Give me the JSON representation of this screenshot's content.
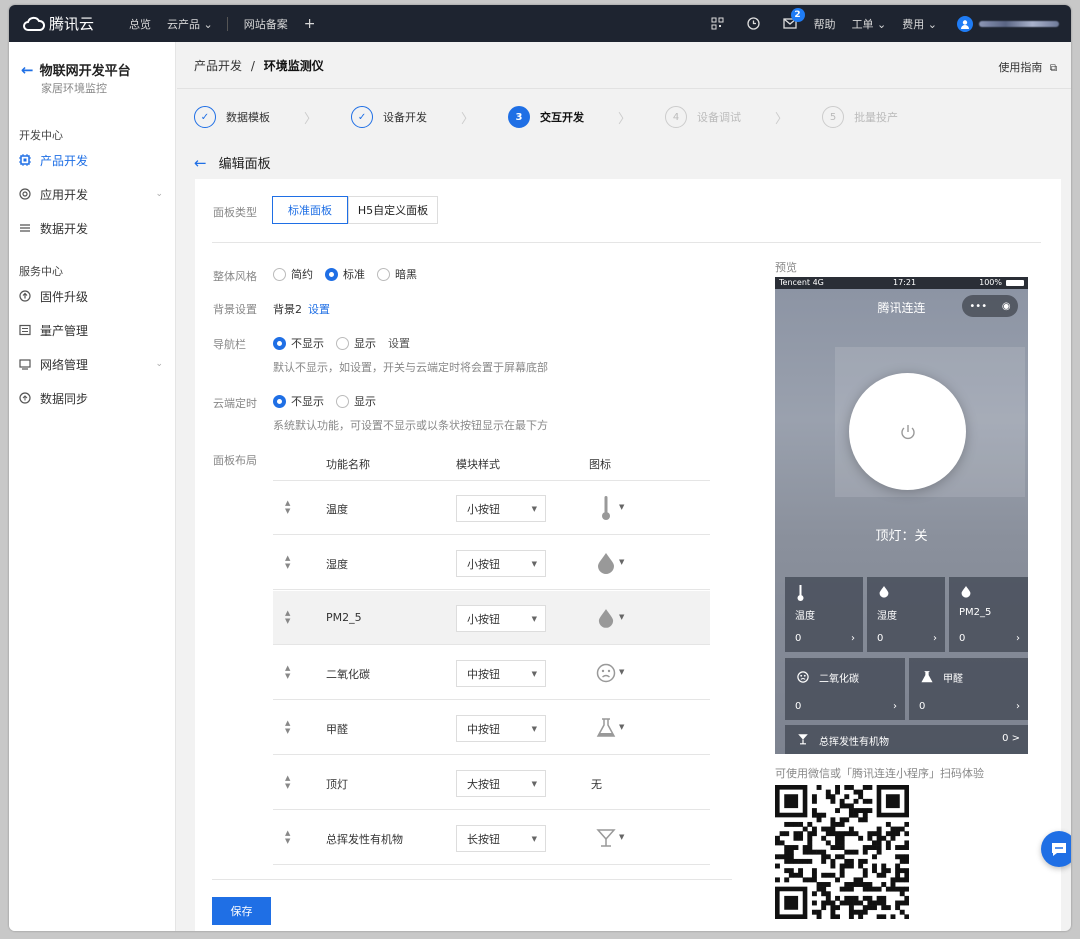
{
  "topbar": {
    "brand": "腾讯云",
    "items": [
      "总览",
      "云产品 ⌄",
      "网站备案"
    ],
    "plus": "+",
    "right_items": {
      "help": "帮助",
      "ticket": "工单 ⌄",
      "billing": "费用 ⌄"
    },
    "mail_badge": "2"
  },
  "sidebar": {
    "back_title": "物联网开发平台",
    "subtitle": "家居环境监控",
    "group1": "开发中心",
    "items1": [
      "产品开发",
      "应用开发",
      "数据开发"
    ],
    "group2": "服务中心",
    "items2": [
      "固件升级",
      "量产管理",
      "网络管理",
      "数据同步"
    ]
  },
  "breadcrumb": {
    "parent": "产品开发",
    "sep": "/",
    "current": "环境监测仪"
  },
  "guide_link": "使用指南",
  "steps": [
    {
      "num": "✓",
      "label": "数据模板",
      "state": "done"
    },
    {
      "num": "✓",
      "label": "设备开发",
      "state": "done"
    },
    {
      "num": "3",
      "label": "交互开发",
      "state": "current"
    },
    {
      "num": "4",
      "label": "设备调试",
      "state": "todo"
    },
    {
      "num": "5",
      "label": "批量投产",
      "state": "todo"
    }
  ],
  "edit_title": "编辑面板",
  "form": {
    "panel_type_label": "面板类型",
    "panel_types": [
      "标准面板",
      "H5自定义面板"
    ],
    "style_label": "整体风格",
    "styles": [
      "简约",
      "标准",
      "暗黑"
    ],
    "bg_label": "背景设置",
    "bg_value": "背景2",
    "bg_link": "设置",
    "nav_label": "导航栏",
    "nav_options": [
      "不显示",
      "显示"
    ],
    "nav_link": "设置",
    "nav_hint": "默认不显示，如设置，开关与云端定时将会置于屏幕底部",
    "timer_label": "云端定时",
    "timer_options": [
      "不显示",
      "显示"
    ],
    "timer_hint": "系统默认功能，可设置不显示或以条状按钮显示在最下方",
    "layout_label": "面板布局",
    "columns": [
      "功能名称",
      "模块样式",
      "图标"
    ],
    "rows": [
      {
        "name": "温度",
        "style": "小按钮",
        "icon": "thermometer-icon"
      },
      {
        "name": "湿度",
        "style": "小按钮",
        "icon": "drop-icon"
      },
      {
        "name": "PM2_5",
        "style": "小按钮",
        "icon": "drop-icon"
      },
      {
        "name": "二氧化碳",
        "style": "中按钮",
        "icon": "face-icon"
      },
      {
        "name": "甲醛",
        "style": "中按钮",
        "icon": "flask-icon"
      },
      {
        "name": "顶灯",
        "style": "大按钮",
        "icon": "无"
      },
      {
        "name": "总挥发性有机物",
        "style": "长按钮",
        "icon": "cup-icon"
      }
    ],
    "save": "保存"
  },
  "preview": {
    "label": "预览",
    "carrier": "Tencent 4G",
    "time": "17:21",
    "battery": "100%",
    "title": "腾讯连连",
    "lamp_status": "顶灯：关",
    "tiles_small": [
      {
        "name": "温度",
        "value": "0"
      },
      {
        "name": "湿度",
        "value": "0"
      },
      {
        "name": "PM2_5",
        "value": "0"
      }
    ],
    "tiles_medium": [
      {
        "name": "二氧化碳",
        "value": "0"
      },
      {
        "name": "甲醛",
        "value": "0"
      }
    ],
    "tile_long": {
      "name": "总挥发性有机物",
      "value": "0 >"
    },
    "qr_label": "可使用微信或「腾讯连连小程序」扫码体验"
  },
  "colors": {
    "primary": "#1f6fe5",
    "topbar": "#1e2430"
  }
}
